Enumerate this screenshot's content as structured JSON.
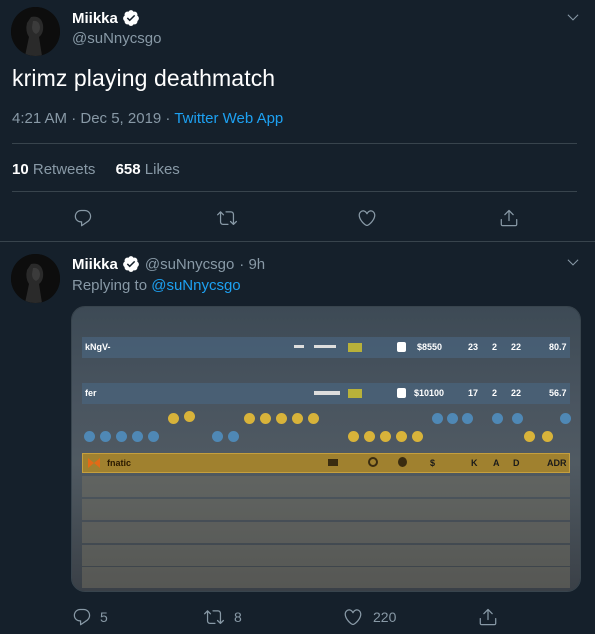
{
  "main_tweet": {
    "author_name": "Miikka",
    "handle": "@suNnycsgo",
    "text": "krimz playing deathmatch",
    "time": "4:21 AM · Dec 5, 2019",
    "separator": " · ",
    "source": "Twitter Web App",
    "retweets_count": "10",
    "retweets_label": "Retweets",
    "likes_count": "658",
    "likes_label": "Likes"
  },
  "reply_tweet": {
    "author_name": "Miikka",
    "handle": "@suNnycsgo",
    "age": "· 9h",
    "replying_label": "Replying to",
    "replying_to": "@suNnycsgo",
    "reply_count": "5",
    "retweet_count": "8",
    "like_count": "220"
  },
  "scoreboard": {
    "ct_rows": [
      {
        "name": "kNgV-",
        "money": "$8550",
        "k": "23",
        "a": "2",
        "d": "22",
        "adr": "80.7"
      },
      {
        "name": "fer",
        "money": "$10100",
        "k": "17",
        "a": "2",
        "d": "22",
        "adr": "56.7"
      }
    ],
    "team_label": "fnatic",
    "team_headers": {
      "money": "$",
      "k": "K",
      "a": "A",
      "d": "D",
      "adr": "ADR"
    }
  },
  "colors": {
    "background": "#15202b",
    "text_secondary": "#8899a6",
    "link": "#1da1f2",
    "divider": "#38444d",
    "fnatic_orange": "#a0812f"
  },
  "icons": [
    "verified-badge-icon",
    "chevron-down-icon",
    "reply-icon",
    "retweet-icon",
    "like-icon",
    "share-icon"
  ]
}
